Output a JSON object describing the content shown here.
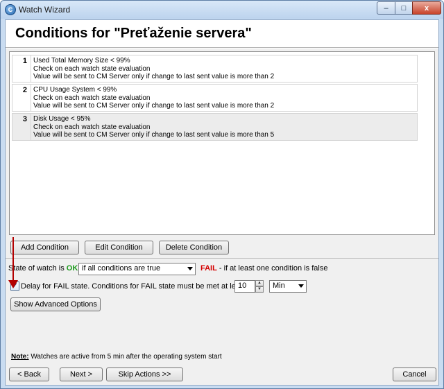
{
  "window": {
    "title": "Watch Wizard",
    "controls": {
      "minimize": "–",
      "maximize": "□",
      "close": "x"
    }
  },
  "header": {
    "title": "Conditions for \"Preťaženie servera\""
  },
  "conditions": [
    {
      "number": "1",
      "line1": "Used Total Memory Size < 99%",
      "line2": "Check on each watch state evaluation",
      "line3": "Value will be sent to CM Server only if change to last sent value is more than 2"
    },
    {
      "number": "2",
      "line1": "CPU Usage System < 99%",
      "line2": "Check on each watch state evaluation",
      "line3": "Value will be sent to CM Server only if change to last sent value is more than 2"
    },
    {
      "number": "3",
      "line1": "Disk Usage < 95%",
      "line2": "Check on each watch state evaluation",
      "line3": "Value will be sent to CM Server only if change to last sent value is more than 5"
    }
  ],
  "condition_buttons": {
    "add": "Add Condition",
    "edit": "Edit Condition",
    "delete": "Delete Condition"
  },
  "state": {
    "prefix": "State of watch is",
    "ok_label": "OK",
    "ok_select_value": "if all conditions are true",
    "fail_label": "FAIL",
    "fail_text": "- if at least one condition is false"
  },
  "delay": {
    "checked": true,
    "check_mark": "✓",
    "label": "Delay for FAIL state. Conditions for FAIL state must be met at least",
    "value": "10",
    "unit": "Min"
  },
  "advanced_button": "Show Advanced Options",
  "note": {
    "prefix": "Note:",
    "text": "Watches are active from 5 min after the operating system start"
  },
  "footer": {
    "back": "< Back",
    "next": "Next >",
    "skip": "Skip Actions >>",
    "cancel": "Cancel"
  },
  "colors": {
    "ok": "#1a9a1a",
    "fail": "#d40000",
    "annotation_arrow": "#b30000"
  }
}
